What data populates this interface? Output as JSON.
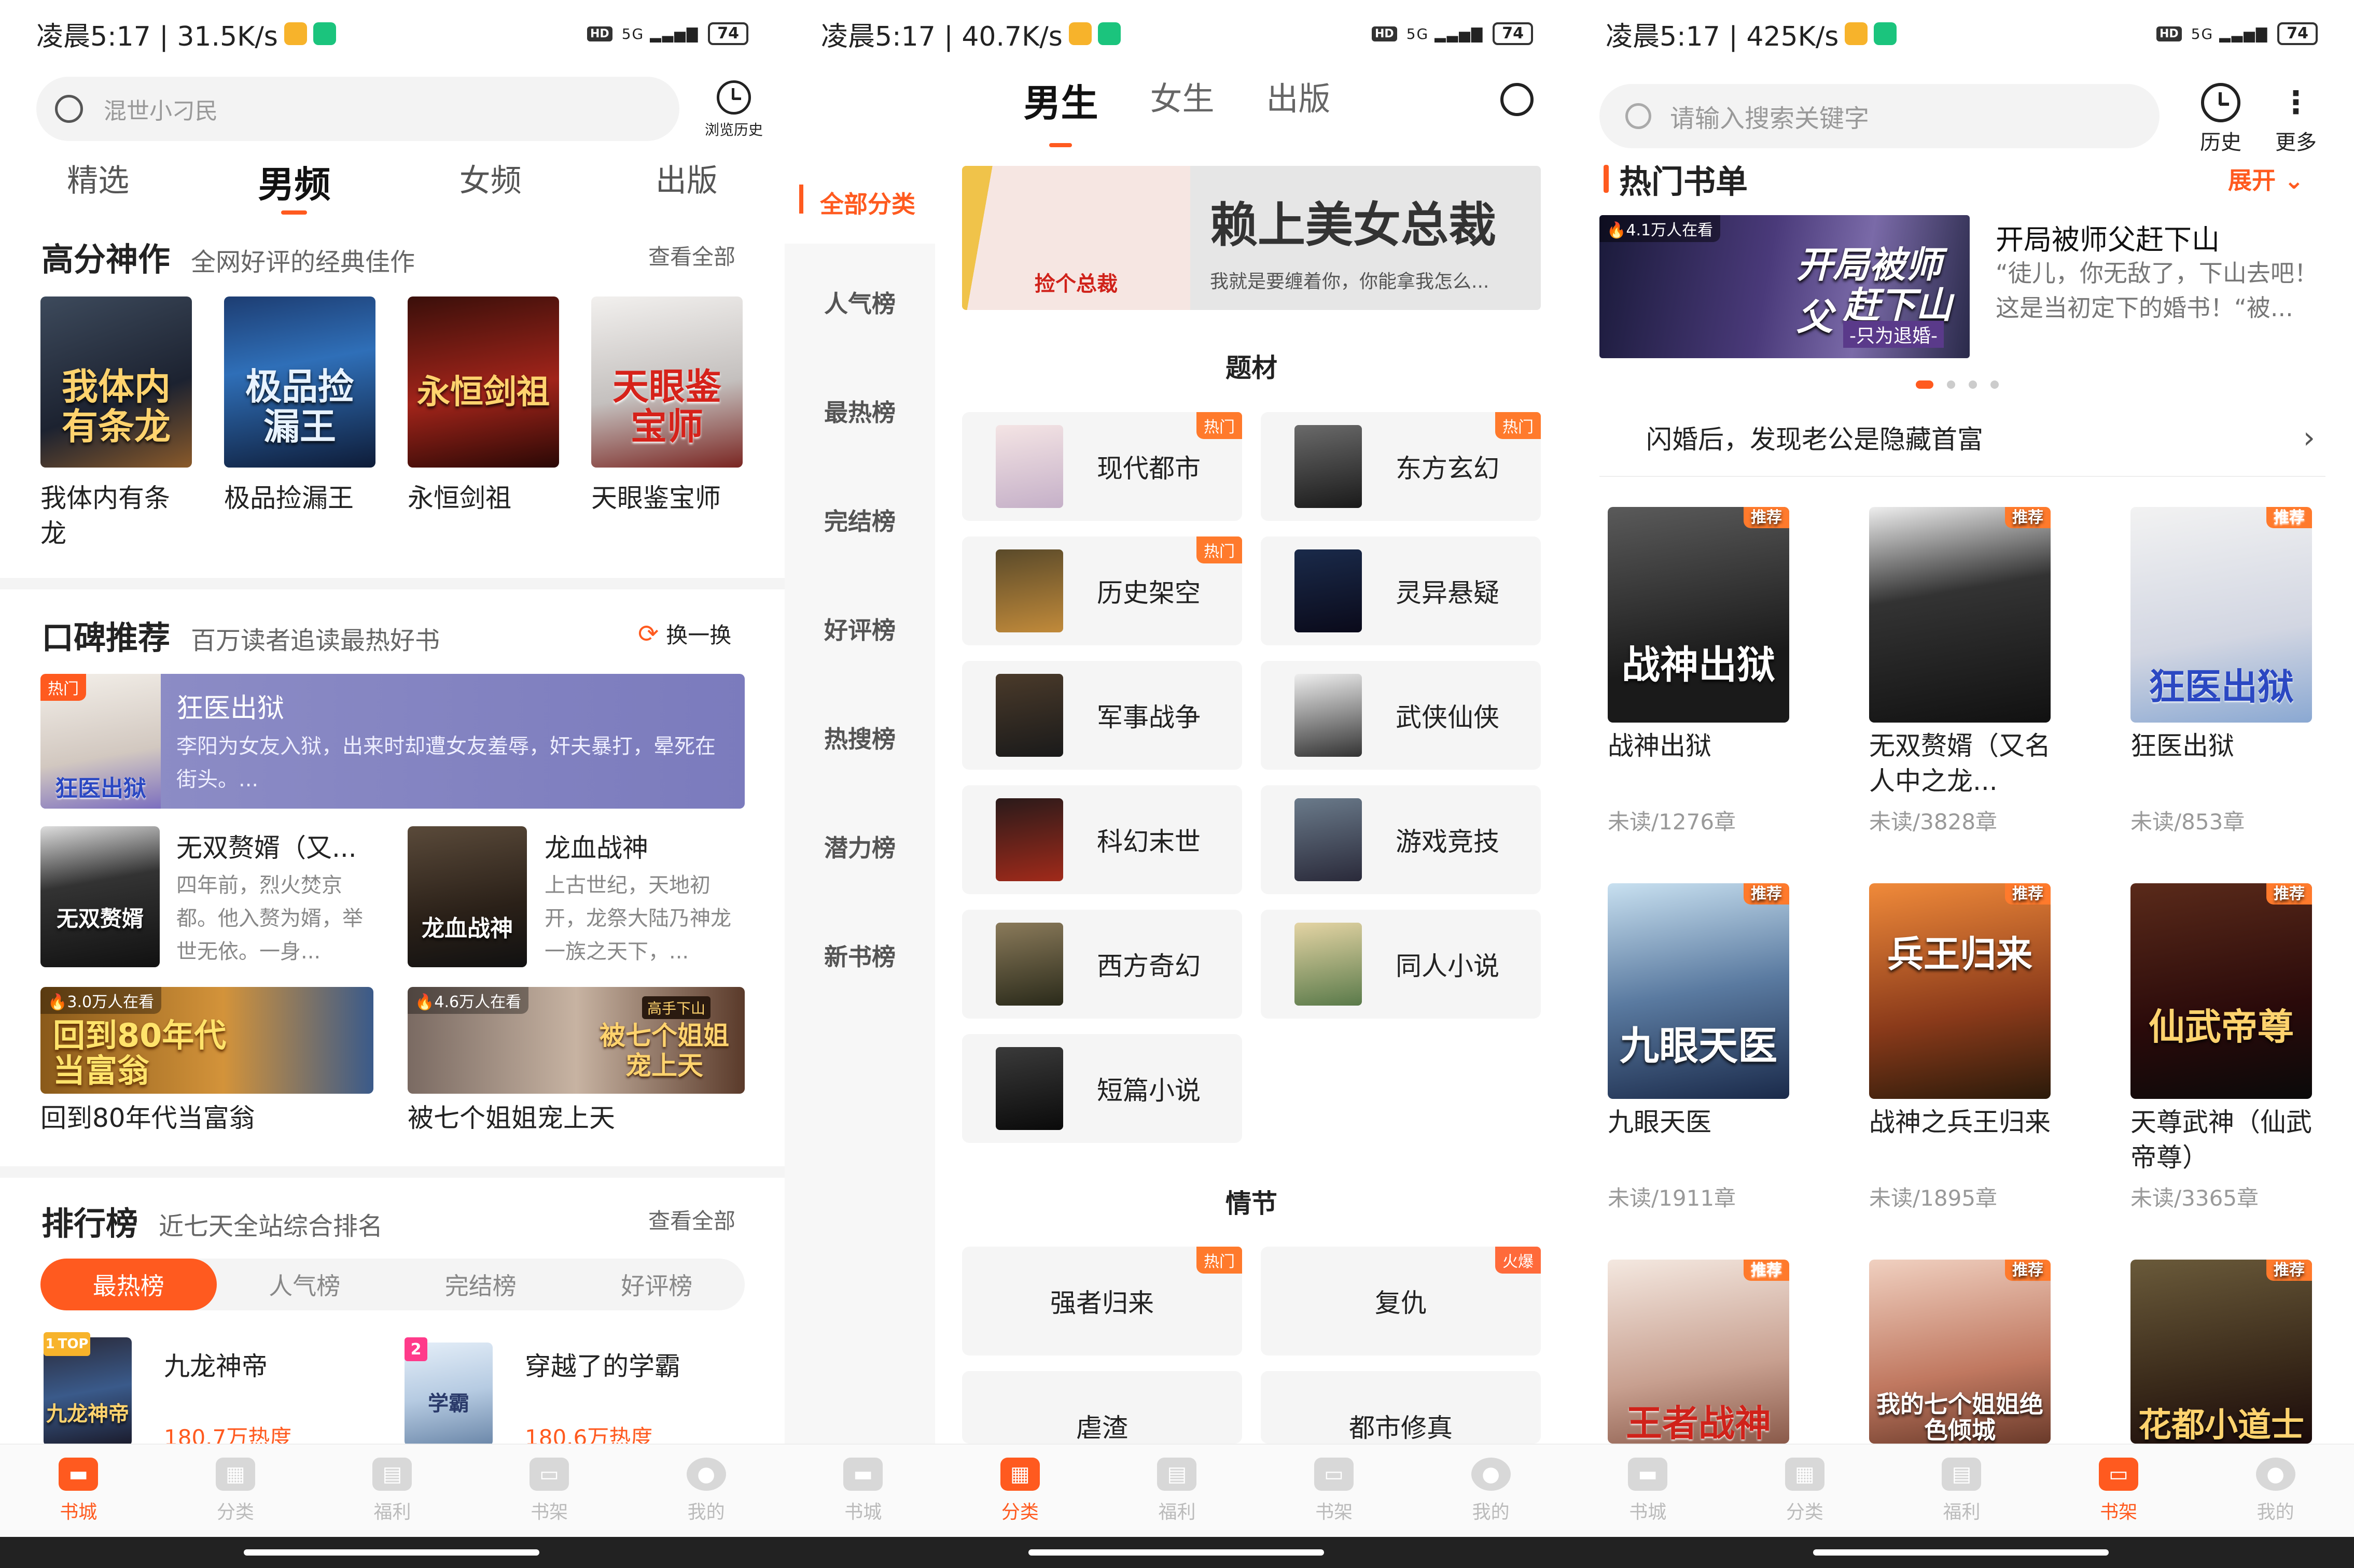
{
  "colors": {
    "accent": "#ff5a1f",
    "tag": "#ff7a2c"
  },
  "status_bars": [
    {
      "time_speed": "凌晨5:17 | 31.5K/s",
      "network": "5G",
      "battery": "74"
    },
    {
      "time_speed": "凌晨5:17 | 40.7K/s",
      "network": "5G",
      "battery": "74"
    },
    {
      "time_speed": "凌晨5:17 | 425K/s",
      "network": "5G",
      "battery": "74"
    }
  ],
  "hd": "HD",
  "bottom_nav": [
    "书城",
    "分类",
    "福利",
    "书架",
    "我的"
  ],
  "p1": {
    "search_placeholder": "混世小刁民",
    "history_label": "浏览历史",
    "tabs": [
      "精选",
      "男频",
      "女频",
      "出版"
    ],
    "s1": {
      "title": "高分神作",
      "sub": "全网好评的经典佳作",
      "more": "查看全部",
      "books": [
        {
          "name": "我体内有条龙",
          "cover_text": "我体内有条龙"
        },
        {
          "name": "极品捡漏王",
          "cover_text": "极品捡漏王"
        },
        {
          "name": "永恒剑祖",
          "cover_text": "永恒剑祖"
        },
        {
          "name": "天眼鉴宝师",
          "cover_text": "天眼鉴宝师"
        }
      ]
    },
    "s2": {
      "title": "口碑推荐",
      "sub": "百万读者追读最热好书",
      "refresh": "换一换",
      "featured": {
        "tag": "热门",
        "name": "狂医出狱",
        "desc": "李阳为女友入狱，出来时却遭女友羞辱，奸夫暴打，晕死在街头。...",
        "cover_text": "狂医出狱"
      },
      "small": [
        {
          "name": "无双赘婿（又...",
          "desc": "四年前，烈火焚京都。他入赘为婿，举世无依。一身...",
          "cover_text": "无双赘婿"
        },
        {
          "name": "龙血战神",
          "desc": "上古世纪，天地初开，龙祭大陆乃神龙一族之天下，...",
          "cover_text": "龙血战神"
        }
      ],
      "videos": [
        {
          "viewers": "3.0万人在看",
          "banner": "回到80年代当富翁",
          "name": "回到80年代当富翁"
        },
        {
          "viewers": "4.6万人在看",
          "banner": "被七个姐姐宠上天",
          "badge": "高手下山",
          "name": "被七个姐姐宠上天"
        }
      ]
    },
    "s3": {
      "title": "排行榜",
      "sub": "近七天全站综合排名",
      "more": "查看全部",
      "tabs": [
        "最热榜",
        "人气榜",
        "完结榜",
        "好评榜"
      ],
      "items": [
        {
          "rank": "1",
          "top": "TOP",
          "name": "九龙神帝",
          "heat": "180.7万热度",
          "cover_text": "九龙神帝"
        },
        {
          "rank": "2",
          "name": "穿越了的学霸",
          "heat": "180.6万热度",
          "cover_text": "学霸"
        }
      ]
    }
  },
  "p2": {
    "tabs": [
      "男生",
      "女生",
      "出版"
    ],
    "side": [
      "全部分类",
      "人气榜",
      "最热榜",
      "完结榜",
      "好评榜",
      "热搜榜",
      "潜力榜",
      "新书榜"
    ],
    "banner": {
      "title": "赖上美女总裁",
      "sub": "我就是要缠着你，你能拿我怎么...",
      "cover_text": "捡个总裁"
    },
    "sec1": "题材",
    "cats": [
      {
        "label": "现代都市",
        "tag": "热门"
      },
      {
        "label": "东方玄幻",
        "tag": "热门"
      },
      {
        "label": "历史架空",
        "tag": "热门"
      },
      {
        "label": "灵异悬疑"
      },
      {
        "label": "军事战争"
      },
      {
        "label": "武侠仙侠"
      },
      {
        "label": "科幻末世"
      },
      {
        "label": "游戏竞技"
      },
      {
        "label": "西方奇幻"
      },
      {
        "label": "同人小说"
      },
      {
        "label": "短篇小说"
      }
    ],
    "sec2": "情节",
    "plots": [
      {
        "label": "强者归来",
        "tag": "热门"
      },
      {
        "label": "复仇",
        "tag": "火爆"
      },
      {
        "label": "虐渣"
      },
      {
        "label": "都市修真"
      }
    ]
  },
  "p3": {
    "search_placeholder": "请输入搜索关键字",
    "history": "历史",
    "more": "更多",
    "hot_title": "热门书单",
    "expand": "展开",
    "carousel": {
      "viewers": "4.1万人在看",
      "banner_line1": "开局被师父",
      "banner_line2": "赶下山",
      "banner_sub": "-只为退婚-",
      "title": "开局被师父赶下山",
      "desc": "“徒儿，你无敌了，下山去吧！这是当初定下的婚书！“被..."
    },
    "notice": "闪婚后，发现老公是隐藏首富",
    "shelf": [
      {
        "name": "战神出狱",
        "progress": "未读/1276章",
        "tag": "推荐",
        "cover_text": "战神出狱"
      },
      {
        "name": "无双赘婿（又名人中之龙...",
        "progress": "未读/3828章",
        "tag": "推荐",
        "cover_text": ""
      },
      {
        "name": "狂医出狱",
        "progress": "未读/853章",
        "tag": "推荐",
        "cover_text": "狂医出狱"
      },
      {
        "name": "九眼天医",
        "progress": "未读/1911章",
        "tag": "推荐",
        "cover_text": "九眼天医"
      },
      {
        "name": "战神之兵王归来",
        "progress": "未读/1895章",
        "tag": "推荐",
        "cover_text": "兵王归来"
      },
      {
        "name": "天尊武神（仙武帝尊）",
        "progress": "未读/3365章",
        "tag": "推荐",
        "cover_text": "仙武帝尊"
      },
      {
        "name": "",
        "progress": "",
        "tag": "推荐",
        "cover_text": "王者战神"
      },
      {
        "name": "",
        "progress": "",
        "tag": "推荐",
        "cover_text": "我的七个姐姐绝色倾城"
      },
      {
        "name": "",
        "progress": "",
        "tag": "推荐",
        "cover_text": "花都小道士"
      }
    ]
  }
}
